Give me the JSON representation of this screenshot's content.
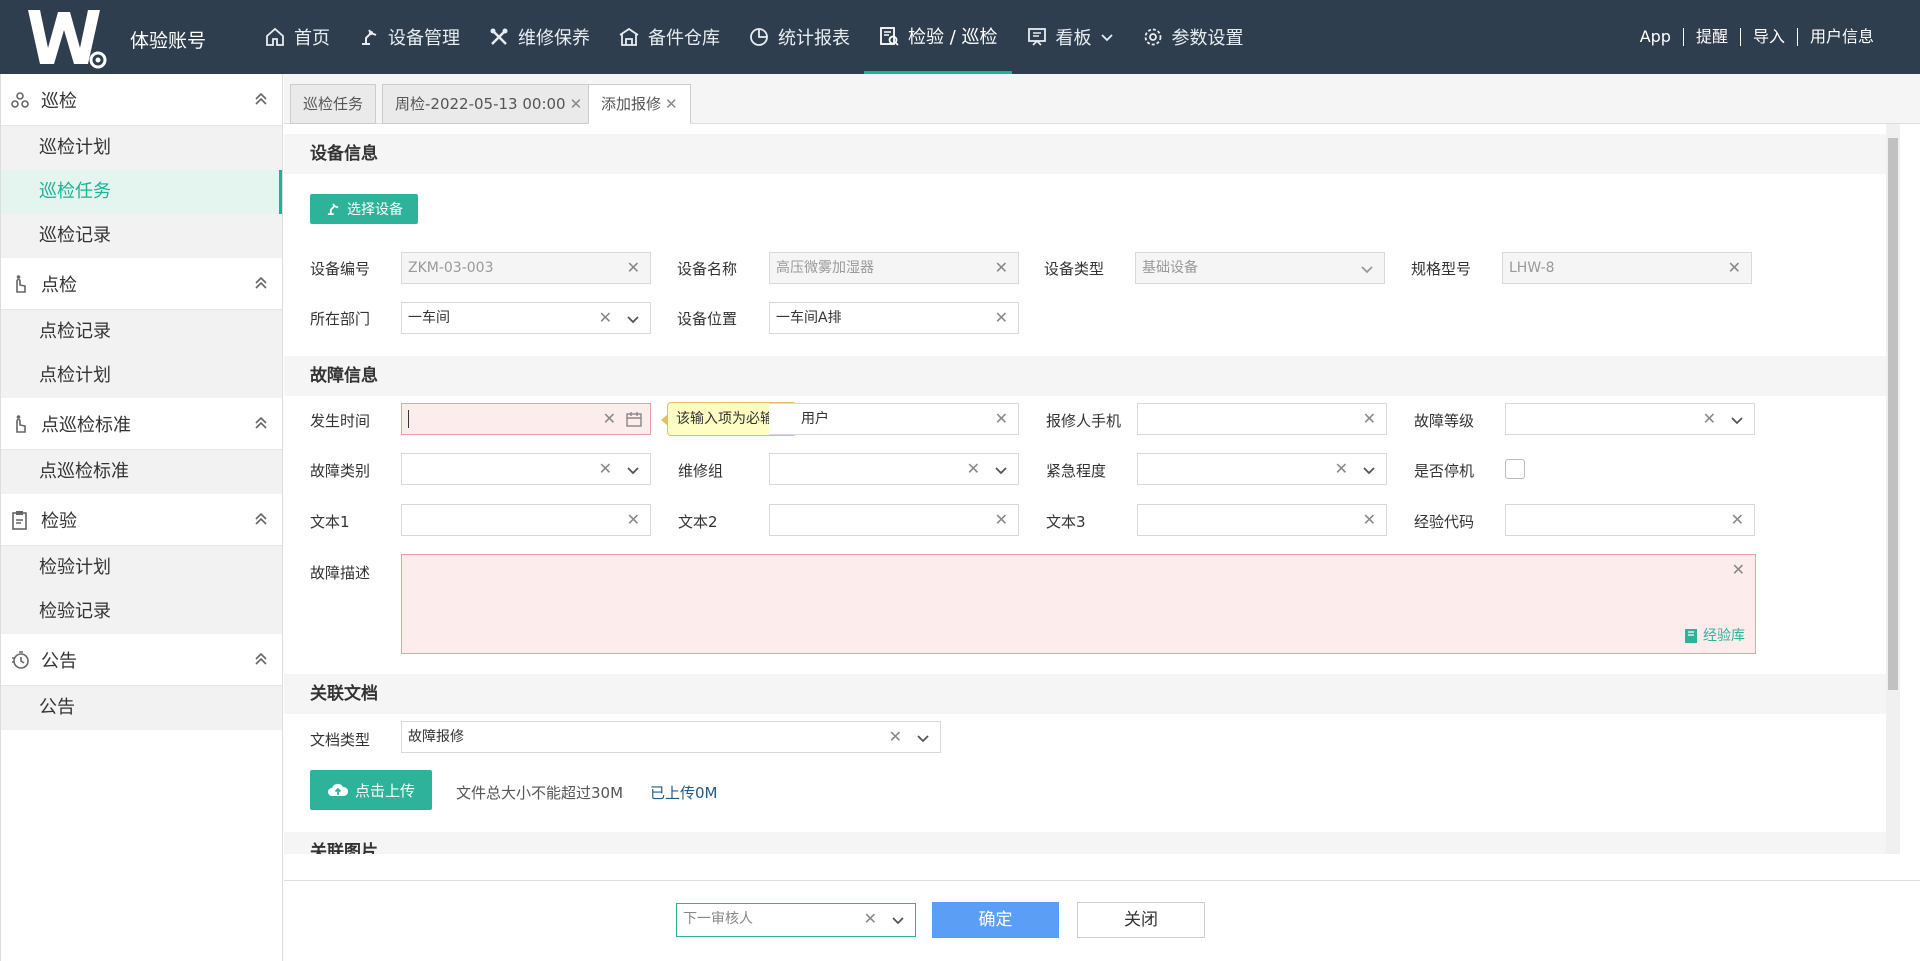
{
  "header": {
    "account": "体验账号",
    "nav": [
      {
        "label": "首页",
        "icon": "home-icon"
      },
      {
        "label": "设备管理",
        "icon": "robot-arm-icon"
      },
      {
        "label": "维修保养",
        "icon": "tools-icon"
      },
      {
        "label": "备件仓库",
        "icon": "warehouse-icon"
      },
      {
        "label": "统计报表",
        "icon": "pie-chart-icon"
      },
      {
        "label": "检验 / 巡检",
        "icon": "inspect-icon",
        "active": true
      },
      {
        "label": "看板",
        "icon": "board-icon"
      },
      {
        "label": "参数设置",
        "icon": "gear-icon"
      }
    ],
    "right_links": [
      "App",
      "提醒",
      "导入",
      "用户信息"
    ]
  },
  "sidebar": {
    "groups": [
      {
        "label": "巡检",
        "items": [
          "巡检计划",
          "巡检任务",
          "巡检记录"
        ]
      },
      {
        "label": "点检",
        "items": [
          "点检记录",
          "点检计划"
        ]
      },
      {
        "label": "点巡检标准",
        "items": [
          "点巡检标准"
        ]
      },
      {
        "label": "检验",
        "items": [
          "检验计划",
          "检验记录"
        ]
      },
      {
        "label": "公告",
        "items": [
          "公告"
        ]
      }
    ],
    "active_item": "巡检任务"
  },
  "tabs": [
    {
      "label": "巡检任务"
    },
    {
      "label": "周检-2022-05-13 00:00"
    },
    {
      "label": "添加报修"
    }
  ],
  "device": {
    "title": "设备信息",
    "select_button": "选择设备",
    "code_label": "设备编号",
    "code": "ZKM-03-003",
    "name_label": "设备名称",
    "name": "高压微雾加湿器",
    "type_label": "设备类型",
    "type": "基础设备",
    "model_label": "规格型号",
    "model": "LHW-8",
    "dept_label": "所在部门",
    "dept": "一车间",
    "location_label": "设备位置",
    "location": "一车间A排"
  },
  "fault": {
    "title": "故障信息",
    "time_label": "发生时间",
    "tooltip": "该输入项为必输项",
    "reporter_value": "用户",
    "phone_label": "报修人手机",
    "level_label": "故障等级",
    "category_label": "故障类别",
    "group_label": "维修组",
    "urgency_label": "紧急程度",
    "stop_label": "是否停机",
    "text1_label": "文本1",
    "text2_label": "文本2",
    "text3_label": "文本3",
    "exp_code_label": "经验代码",
    "desc_label": "故障描述",
    "experience_link": "经验库"
  },
  "docs": {
    "title": "关联文档",
    "type_label": "文档类型",
    "type_value": "故障报修",
    "upload_button": "点击上传",
    "size_note": "文件总大小不能超过30M",
    "uploaded": "已上传0M"
  },
  "images": {
    "title": "关联图片"
  },
  "footer": {
    "reviewer_placeholder": "下一审核人",
    "confirm": "确定",
    "close": "关闭"
  }
}
